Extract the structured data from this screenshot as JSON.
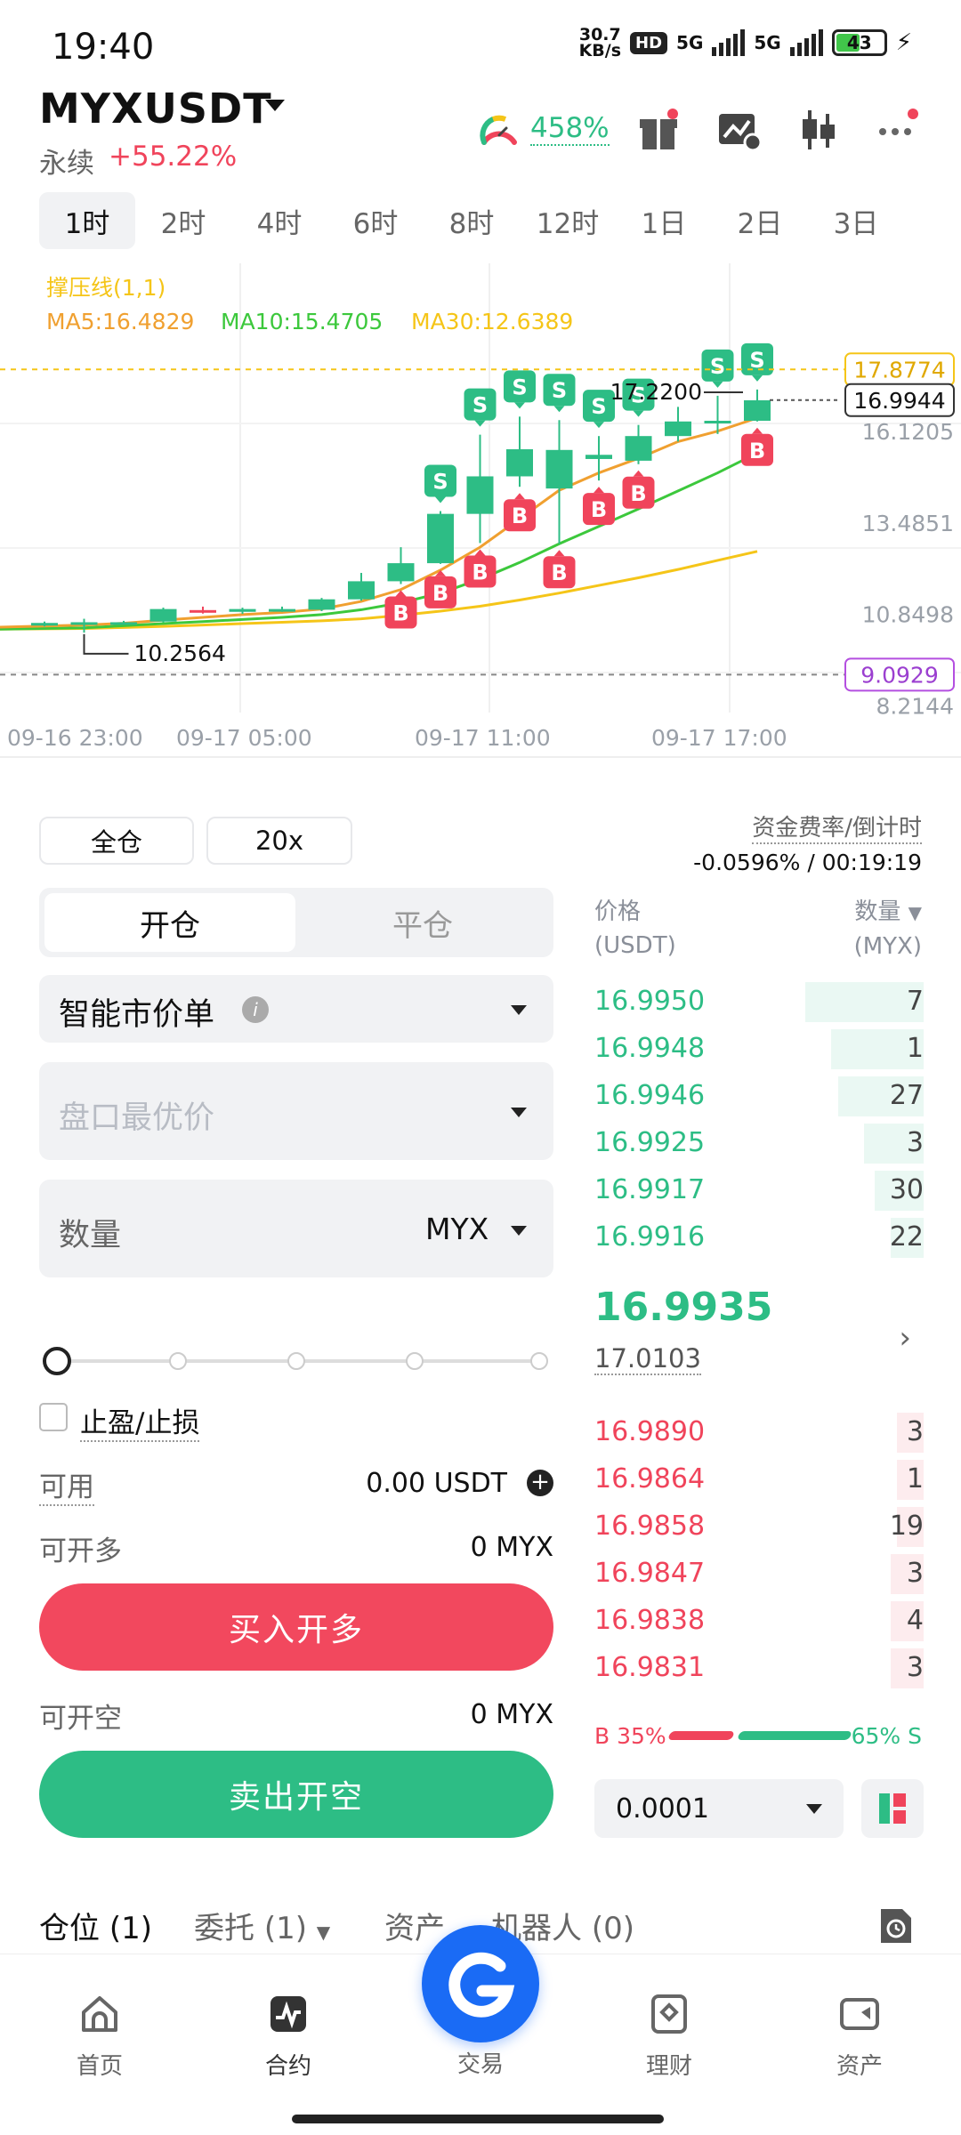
{
  "status_bar": {
    "time": "19:40",
    "net_speed_value": "30.7",
    "net_speed_unit": "KB/s",
    "hd": "HD",
    "sim1": "5G",
    "sim2": "5G",
    "battery": "43"
  },
  "header": {
    "pair": "MYXUSDT",
    "type": "永续",
    "change": "+55.22%",
    "gauge_pct": "458%"
  },
  "timeframes": {
    "items": [
      "1时",
      "2时",
      "4时",
      "6时",
      "8时",
      "12时",
      "1日",
      "2日",
      "3日"
    ],
    "active_index": 0
  },
  "chart_data": {
    "type": "candlestick",
    "indicator_title": "撑压线(1,1)",
    "ma_labels": [
      "MA5:16.4829",
      "MA10:15.4705",
      "MA30:12.6389"
    ],
    "ma_colors": [
      "#f0a030",
      "#3cc83c",
      "#f5c518"
    ],
    "y_ticks": [
      "16.1205",
      "13.4851",
      "10.8498",
      "8.2144"
    ],
    "x_ticks": [
      "09-16 23:00",
      "09-17 05:00",
      "09-17 11:00",
      "09-17 17:00"
    ],
    "resistance_label": "17.8774",
    "support_label": "9.0929",
    "current_price_label": "16.9944",
    "high_annotation": "17.2200",
    "low_annotation": "10.2564",
    "candles": [
      {
        "o": 10.55,
        "c": 10.58,
        "h": 10.62,
        "l": 10.48
      },
      {
        "o": 10.56,
        "c": 10.6,
        "h": 10.7,
        "l": 10.3
      },
      {
        "o": 10.58,
        "c": 10.6,
        "h": 10.64,
        "l": 10.54
      },
      {
        "o": 10.62,
        "c": 10.98,
        "h": 11.02,
        "l": 10.6
      },
      {
        "o": 10.95,
        "c": 10.9,
        "h": 11.05,
        "l": 10.85
      },
      {
        "o": 10.9,
        "c": 10.98,
        "h": 11.02,
        "l": 10.84
      },
      {
        "o": 10.96,
        "c": 10.98,
        "h": 11.05,
        "l": 10.9
      },
      {
        "o": 10.96,
        "c": 11.26,
        "h": 11.3,
        "l": 10.92
      },
      {
        "o": 11.26,
        "c": 11.78,
        "h": 12.02,
        "l": 11.22
      },
      {
        "o": 11.78,
        "c": 12.3,
        "h": 12.76,
        "l": 11.7
      },
      {
        "o": 12.3,
        "c": 13.72,
        "h": 13.8,
        "l": 12.28
      },
      {
        "o": 13.72,
        "c": 14.8,
        "h": 16.0,
        "l": 12.88
      },
      {
        "o": 14.8,
        "c": 15.58,
        "h": 16.52,
        "l": 14.5
      },
      {
        "o": 14.45,
        "c": 15.56,
        "h": 16.42,
        "l": 12.86
      },
      {
        "o": 15.3,
        "c": 15.42,
        "h": 15.96,
        "l": 14.68
      },
      {
        "o": 15.25,
        "c": 15.96,
        "h": 16.28,
        "l": 15.15
      },
      {
        "o": 15.96,
        "c": 16.38,
        "h": 16.8,
        "l": 15.8
      },
      {
        "o": 16.35,
        "c": 16.4,
        "h": 17.12,
        "l": 16.02
      },
      {
        "o": 16.4,
        "c": 16.99,
        "h": 17.3,
        "l": 16.38
      }
    ],
    "ma5": [
      10.46,
      10.52,
      10.57,
      10.66,
      10.74,
      10.82,
      10.88,
      10.98,
      11.2,
      11.54,
      12.1,
      12.76,
      13.58,
      14.4,
      14.9,
      15.32,
      15.8,
      16.1,
      16.48
    ],
    "ma10": [
      10.4,
      10.44,
      10.5,
      10.56,
      10.62,
      10.68,
      10.74,
      10.82,
      10.96,
      11.16,
      11.44,
      11.84,
      12.32,
      12.86,
      13.36,
      13.86,
      14.38,
      14.9,
      15.47
    ],
    "ma30": [
      10.4,
      10.42,
      10.45,
      10.48,
      10.52,
      10.56,
      10.6,
      10.64,
      10.7,
      10.8,
      10.92,
      11.06,
      11.24,
      11.44,
      11.66,
      11.88,
      12.12,
      12.38,
      12.64
    ],
    "buy_markers": [
      9,
      10,
      11,
      12,
      13,
      14,
      15,
      18
    ],
    "sell_markers": [
      10,
      11,
      12,
      13,
      14,
      15,
      17,
      18
    ],
    "ylim": [
      8.0,
      18.5
    ]
  },
  "order_form": {
    "margin_mode": "全仓",
    "leverage": "20x",
    "funding_label": "资金费率/倒计时",
    "funding_value": "-0.0596% / 00:19:19",
    "tab_open": "开仓",
    "tab_close": "平仓",
    "order_type": "智能市价单",
    "price_placeholder": "盘口最优价",
    "qty_label": "数量",
    "qty_unit": "MYX",
    "slider_pct": 0,
    "tpsl_label": "止盈/止损",
    "avail_label": "可用",
    "avail_value": "0.00 USDT",
    "can_long_label": "可开多",
    "can_long_value": "0 MYX",
    "buy_btn": "买入开多",
    "can_short_label": "可开空",
    "can_short_value": "0 MYX",
    "sell_btn": "卖出开空"
  },
  "order_book": {
    "price_head": "价格",
    "price_unit": "(USDT)",
    "qty_head": "数量",
    "qty_unit": "(MYX)",
    "asks": [
      {
        "p": "16.9950",
        "q": "7",
        "d": 0.36
      },
      {
        "p": "16.9948",
        "q": "1",
        "d": 0.28
      },
      {
        "p": "16.9946",
        "q": "27",
        "d": 0.26
      },
      {
        "p": "16.9925",
        "q": "3",
        "d": 0.18
      },
      {
        "p": "16.9917",
        "q": "30",
        "d": 0.15
      },
      {
        "p": "16.9916",
        "q": "22",
        "d": 0.1
      }
    ],
    "last_price": "16.9935",
    "mark_price": "17.0103",
    "bids": [
      {
        "p": "16.9890",
        "q": "3",
        "d": 0.08
      },
      {
        "p": "16.9864",
        "q": "1",
        "d": 0.08
      },
      {
        "p": "16.9858",
        "q": "19",
        "d": 0.08
      },
      {
        "p": "16.9847",
        "q": "3",
        "d": 0.1
      },
      {
        "p": "16.9838",
        "q": "4",
        "d": 0.1
      },
      {
        "p": "16.9831",
        "q": "3",
        "d": 0.1
      }
    ],
    "buy_ratio": "B 35%",
    "sell_ratio": "65% S",
    "precision": "0.0001"
  },
  "positions_tabs": {
    "positions": "仓位",
    "positions_count": "(1)",
    "orders": "委托",
    "orders_count": "(1)",
    "assets": "资产",
    "bots": "机器人",
    "bots_count": "(0)"
  },
  "nav": {
    "home": "首页",
    "contract": "合约",
    "trade": "交易",
    "finance": "理财",
    "assets": "资产"
  },
  "colors": {
    "up": "#2dbd85",
    "down": "#f0445b",
    "accent": "#1a6bf5"
  }
}
